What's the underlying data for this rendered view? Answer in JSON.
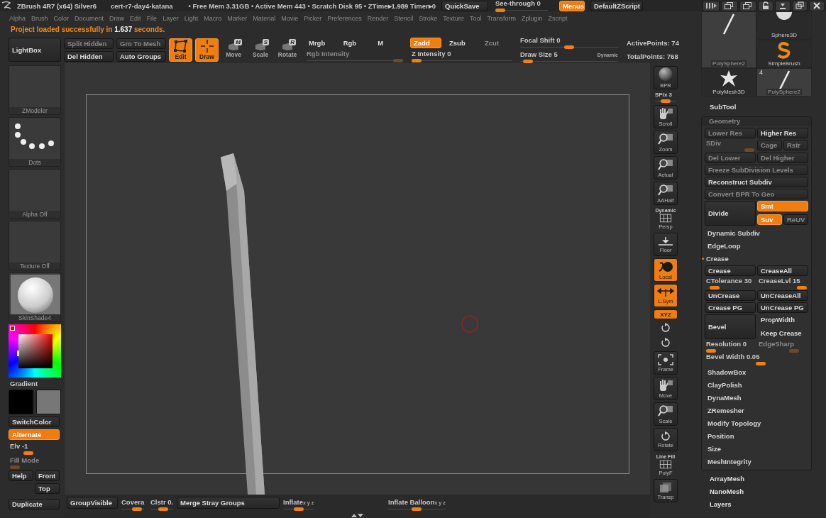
{
  "title_bar": {
    "app_title": "ZBrush 4R7 (x64) Silver6",
    "document": "cert-r7-day4-katana",
    "stats": "• Free Mem 3.31GB • Active Mem 443 • Scratch Disk 95 • ZTime▸1.989 Timer▸0",
    "quicksave": "QuickSave",
    "see_through": {
      "label": "See-through  0",
      "level": 0
    },
    "menus": {
      "label": "Menus",
      "selected": true
    },
    "zscript": "DefaultZScript"
  },
  "menu": [
    "Alpha",
    "Brush",
    "Color",
    "Document",
    "Draw",
    "Edit",
    "File",
    "Layer",
    "Light",
    "Macro",
    "Marker",
    "Material",
    "Movie",
    "Picker",
    "Preferences",
    "Render",
    "Stencil",
    "Stroke",
    "Texture",
    "Tool",
    "Transform",
    "Zplugin",
    "Zscript"
  ],
  "status": "Project loaded successfully in **1.637** seconds.",
  "shelf": {
    "lightbox": "LightBox",
    "mesh_buttons": [
      {
        "label": "Split Hidden",
        "disabled": true
      },
      {
        "label": "Gro To Mesh",
        "disabled": true
      },
      {
        "label": "Del Hidden",
        "disabled": false
      },
      {
        "label": "Auto Groups",
        "disabled": false
      }
    ],
    "modes": [
      {
        "label": "Edit",
        "selected": true
      },
      {
        "label": "Draw",
        "selected": true
      },
      {
        "label": "Move",
        "key": "M",
        "selected": false
      },
      {
        "label": "Scale",
        "key": "S",
        "selected": false
      },
      {
        "label": "Rotate",
        "key": "R",
        "selected": false
      }
    ],
    "rgb": [
      {
        "label": "Mrgb",
        "selected": false
      },
      {
        "label": "Rgb",
        "selected": false
      },
      {
        "label": "M",
        "selected": false
      }
    ],
    "rgb_intensity": {
      "label": "Rgb Intensity",
      "disabled": true,
      "level": 1
    },
    "z": [
      {
        "label": "Zadd",
        "selected": true,
        "disabled": false
      },
      {
        "label": "Zsub",
        "selected": false,
        "disabled": false
      },
      {
        "label": "Zcut",
        "selected": false,
        "disabled": true
      }
    ],
    "z_intensity": {
      "label": "Z Intensity 0",
      "level": 0
    },
    "focal_shift": {
      "label": "Focal Shift 0",
      "level": 0.5
    },
    "draw_size": {
      "label": "Draw Size 5",
      "level": 0.03,
      "dynamic": "Dynamic"
    },
    "points": [
      "ActivePoints: 74",
      "TotalPoints: 768"
    ]
  },
  "left_shelf": {
    "thumbs": [
      {
        "kind": "brush",
        "label": "ZModeler"
      },
      {
        "kind": "stroke",
        "label": "Dots"
      },
      {
        "kind": "alpha",
        "label": "Alpha Off"
      },
      {
        "kind": "texture",
        "label": "Texture Off"
      },
      {
        "kind": "material",
        "label": "SkinShade4"
      }
    ],
    "gradient": "Gradient",
    "swatches": [
      {
        "color": "#000000"
      },
      {
        "color": "#777777"
      }
    ],
    "switch_color": "SwitchColor",
    "alternate": {
      "label": "Alternate",
      "selected": true
    },
    "elv": {
      "label": "Elv -1",
      "level": 0.35,
      "disabled": false
    },
    "fill_mode": {
      "label": "Fill Mode",
      "level": 0,
      "disabled": true
    },
    "buttons": [
      "Help",
      "Front",
      "Top",
      "Duplicate"
    ]
  },
  "right_toolbar": [
    {
      "kind": "button",
      "label": "BPR",
      "on": false
    },
    {
      "kind": "slider",
      "label": "SPix 3",
      "level": 0.5
    },
    {
      "kind": "button",
      "label": "Scroll",
      "on": false
    },
    {
      "kind": "button",
      "label": "Zoom",
      "on": false
    },
    {
      "kind": "button",
      "label": "Actual",
      "on": false
    },
    {
      "kind": "button",
      "label": "AAHalf",
      "on": false
    },
    {
      "kind": "button",
      "label": "Persp",
      "caption": "Dynamic",
      "on": false
    },
    {
      "kind": "button",
      "label": "Floor",
      "on": false
    },
    {
      "kind": "button",
      "label": "Local",
      "on": true
    },
    {
      "kind": "button",
      "label": "L.Sym",
      "on": true
    },
    {
      "kind": "small",
      "label": "XYZ",
      "on": true
    },
    {
      "kind": "icon"
    },
    {
      "kind": "icon"
    },
    {
      "kind": "button",
      "label": "Frame",
      "on": false
    },
    {
      "kind": "button",
      "label": "Move",
      "on": false
    },
    {
      "kind": "button",
      "label": "Scale",
      "on": false
    },
    {
      "kind": "button",
      "label": "Rotate",
      "on": false
    },
    {
      "kind": "button",
      "label": "PolyF",
      "caption": "Line Fill",
      "on": false
    },
    {
      "kind": "button",
      "label": "Transp",
      "on": false
    }
  ],
  "tool_thumbs": [
    {
      "kind": "stick",
      "label": "PolySphere2"
    },
    {
      "kind": "sphere",
      "label": "Sphere3D"
    },
    {
      "kind": "squiggle",
      "label": "SimpleBrush"
    },
    {
      "kind": "star",
      "label": "PolyMesh3D"
    },
    {
      "kind": "stick",
      "label": "PolySphere2",
      "count": "4"
    }
  ],
  "subtool": "SubTool",
  "geometry": {
    "title": "Geometry",
    "rows": [
      {
        "kind": "buttons",
        "items": [
          {
            "kind": "button",
            "label": "Lower Res",
            "disabled": true
          },
          {
            "kind": "button",
            "label": "Higher Res",
            "disabled": false
          }
        ]
      },
      {
        "kind": "buttons",
        "items": [
          {
            "kind": "slider",
            "label": "SDiv",
            "disabled": true,
            "level": 1
          },
          {
            "kind": "button",
            "label": "Cage",
            "disabled": true
          },
          {
            "kind": "button",
            "label": "Rstr",
            "disabled": true
          }
        ]
      },
      {
        "kind": "buttons",
        "items": [
          {
            "kind": "button",
            "label": "Del Lower",
            "disabled": true
          },
          {
            "kind": "button",
            "label": "Del Higher",
            "disabled": true
          }
        ]
      },
      {
        "kind": "buttons",
        "items": [
          {
            "kind": "button",
            "label": "Freeze SubDivision Levels",
            "disabled": true
          }
        ]
      },
      {
        "kind": "buttons",
        "items": [
          {
            "kind": "button",
            "label": "Reconstruct Subdiv",
            "disabled": false
          }
        ]
      },
      {
        "kind": "buttons",
        "items": [
          {
            "kind": "button",
            "label": "Convert BPR To Geo",
            "disabled": true
          }
        ]
      },
      {
        "kind": "group",
        "main": {
          "label": "Divide"
        },
        "rows": [
          [
            {
              "kind": "button",
              "label": "Smt",
              "on": true,
              "disabled": false
            }
          ],
          [
            {
              "kind": "button",
              "label": "Suv",
              "on": true,
              "disabled": false
            },
            {
              "kind": "button",
              "label": "ReUV",
              "on": false,
              "disabled": true
            }
          ]
        ]
      },
      {
        "kind": "section",
        "label": "Dynamic Subdiv",
        "expanded": false
      },
      {
        "kind": "section",
        "label": "EdgeLoop",
        "expanded": false
      },
      {
        "kind": "section",
        "label": "Crease",
        "expanded": true
      },
      {
        "kind": "buttons",
        "items": [
          {
            "kind": "button",
            "label": "Crease",
            "disabled": false
          },
          {
            "kind": "button",
            "label": "CreaseAll",
            "disabled": false
          }
        ]
      },
      {
        "kind": "buttons",
        "items": [
          {
            "kind": "slider",
            "label": "CTolerance 30",
            "disabled": false,
            "level": 0.1
          },
          {
            "kind": "slider",
            "label": "CreaseLvl 15",
            "disabled": false,
            "level": 1
          }
        ]
      },
      {
        "kind": "buttons",
        "items": [
          {
            "kind": "button",
            "label": "UnCrease",
            "disabled": false
          },
          {
            "kind": "button",
            "label": "UnCreaseAll",
            "disabled": false
          }
        ]
      },
      {
        "kind": "buttons",
        "items": [
          {
            "kind": "button",
            "label": "Crease PG",
            "disabled": false
          },
          {
            "kind": "button",
            "label": "UnCrease PG",
            "disabled": false
          }
        ]
      },
      {
        "kind": "group",
        "main": {
          "label": "Bevel"
        },
        "rows": [
          [
            {
              "kind": "text",
              "label": "PropWidth"
            }
          ],
          [
            {
              "kind": "text",
              "label": "Keep Crease"
            }
          ]
        ]
      },
      {
        "kind": "buttons",
        "items": [
          {
            "kind": "slider",
            "label": "Resolution 0",
            "disabled": false,
            "level": 0
          },
          {
            "kind": "slider",
            "label": "EdgeSharp",
            "disabled": true,
            "level": 0.8
          }
        ]
      },
      {
        "kind": "buttons",
        "items": [
          {
            "kind": "slider",
            "label": "Bevel Width 0.05",
            "disabled": false,
            "level": 0.55
          }
        ]
      },
      {
        "kind": "section",
        "label": "ShadowBox",
        "expanded": false
      },
      {
        "kind": "section",
        "label": "ClayPolish",
        "expanded": false
      },
      {
        "kind": "section",
        "label": "DynaMesh",
        "expanded": false
      },
      {
        "kind": "section",
        "label": "ZRemesher",
        "expanded": false
      },
      {
        "kind": "section",
        "label": "Modify Topology",
        "expanded": false
      },
      {
        "kind": "section",
        "label": "Position",
        "expanded": false
      },
      {
        "kind": "section",
        "label": "Size",
        "expanded": false
      },
      {
        "kind": "section",
        "label": "MeshIntegrity",
        "expanded": false
      }
    ]
  },
  "sections": [
    "ArrayMesh",
    "NanoMesh",
    "Layers"
  ],
  "bottom": [
    {
      "kind": "button",
      "label": "GroupVisible"
    },
    {
      "kind": "slider",
      "label": "Covera",
      "level": 0.8
    },
    {
      "kind": "slider",
      "label": "Clstr 0.",
      "level": 0.6
    },
    {
      "kind": "button",
      "label": "Merge Stray Groups"
    },
    {
      "kind": "slider",
      "label": "Inflate",
      "level": 0.5,
      "axes": "x y z"
    },
    {
      "kind": "slider",
      "label": "Inflate Balloon",
      "level": 0.5,
      "axes": "x y z"
    }
  ]
}
